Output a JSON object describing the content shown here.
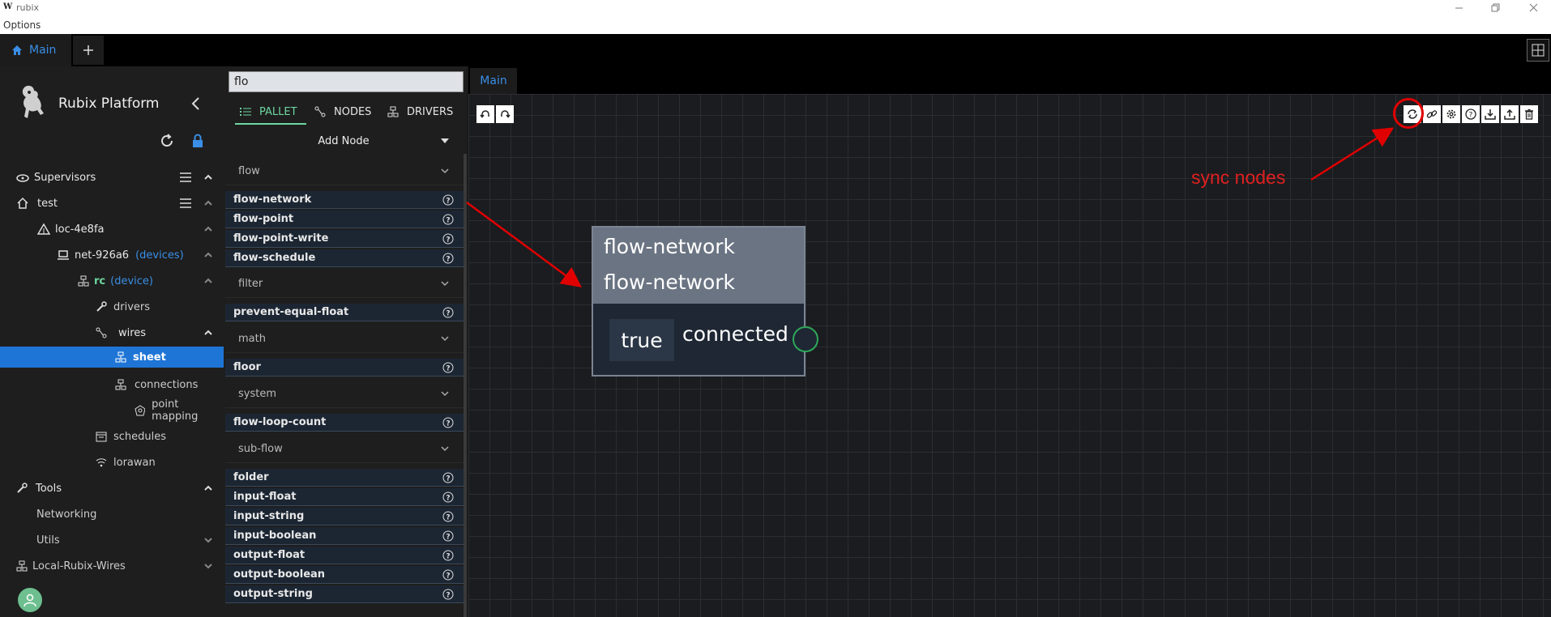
{
  "window": {
    "logo": "W",
    "title": "rubix",
    "menu": "Options"
  },
  "tabs": {
    "main_label": "Main",
    "add_label": "+"
  },
  "sidebar": {
    "brand": "Rubix Platform",
    "items": [
      {
        "label": "Supervisors"
      },
      {
        "label": "test"
      },
      {
        "label": "loc-4e8fa"
      },
      {
        "label": "net-926a6",
        "extra": "(devices)"
      },
      {
        "label": "rc",
        "extra": "(device)"
      },
      {
        "label": "drivers"
      },
      {
        "label": "wires"
      },
      {
        "label": "sheet"
      },
      {
        "label": "connections"
      },
      {
        "label": "point mapping"
      },
      {
        "label": "schedules"
      },
      {
        "label": "lorawan"
      },
      {
        "label": "Tools"
      },
      {
        "label": "Networking"
      },
      {
        "label": "Utils"
      },
      {
        "label": "Local-Rubix-Wires"
      }
    ]
  },
  "pallet": {
    "search_value": "flo",
    "tabs": [
      "PALLET",
      "NODES",
      "DRIVERS"
    ],
    "add_node": "Add Node",
    "groups": [
      {
        "name": "flow",
        "items": [
          "flow-network",
          "flow-point",
          "flow-point-write",
          "flow-schedule"
        ]
      },
      {
        "name": "filter",
        "items": [
          "prevent-equal-float"
        ]
      },
      {
        "name": "math",
        "items": [
          "floor"
        ]
      },
      {
        "name": "system",
        "items": [
          "flow-loop-count"
        ]
      },
      {
        "name": "sub-flow",
        "items": [
          "folder",
          "input-float",
          "input-string",
          "input-boolean",
          "output-float",
          "output-boolean",
          "output-string"
        ]
      }
    ]
  },
  "canvas": {
    "tab_label": "Main",
    "node": {
      "title1": "flow-network",
      "title2": "flow-network",
      "value": "true",
      "output": "connected"
    },
    "annotation": "sync nodes"
  },
  "colors": {
    "accent": "#1f75d6",
    "pallet_accent": "#6dd6a0",
    "annotation": "#e02020",
    "port": "#2ea85a"
  }
}
